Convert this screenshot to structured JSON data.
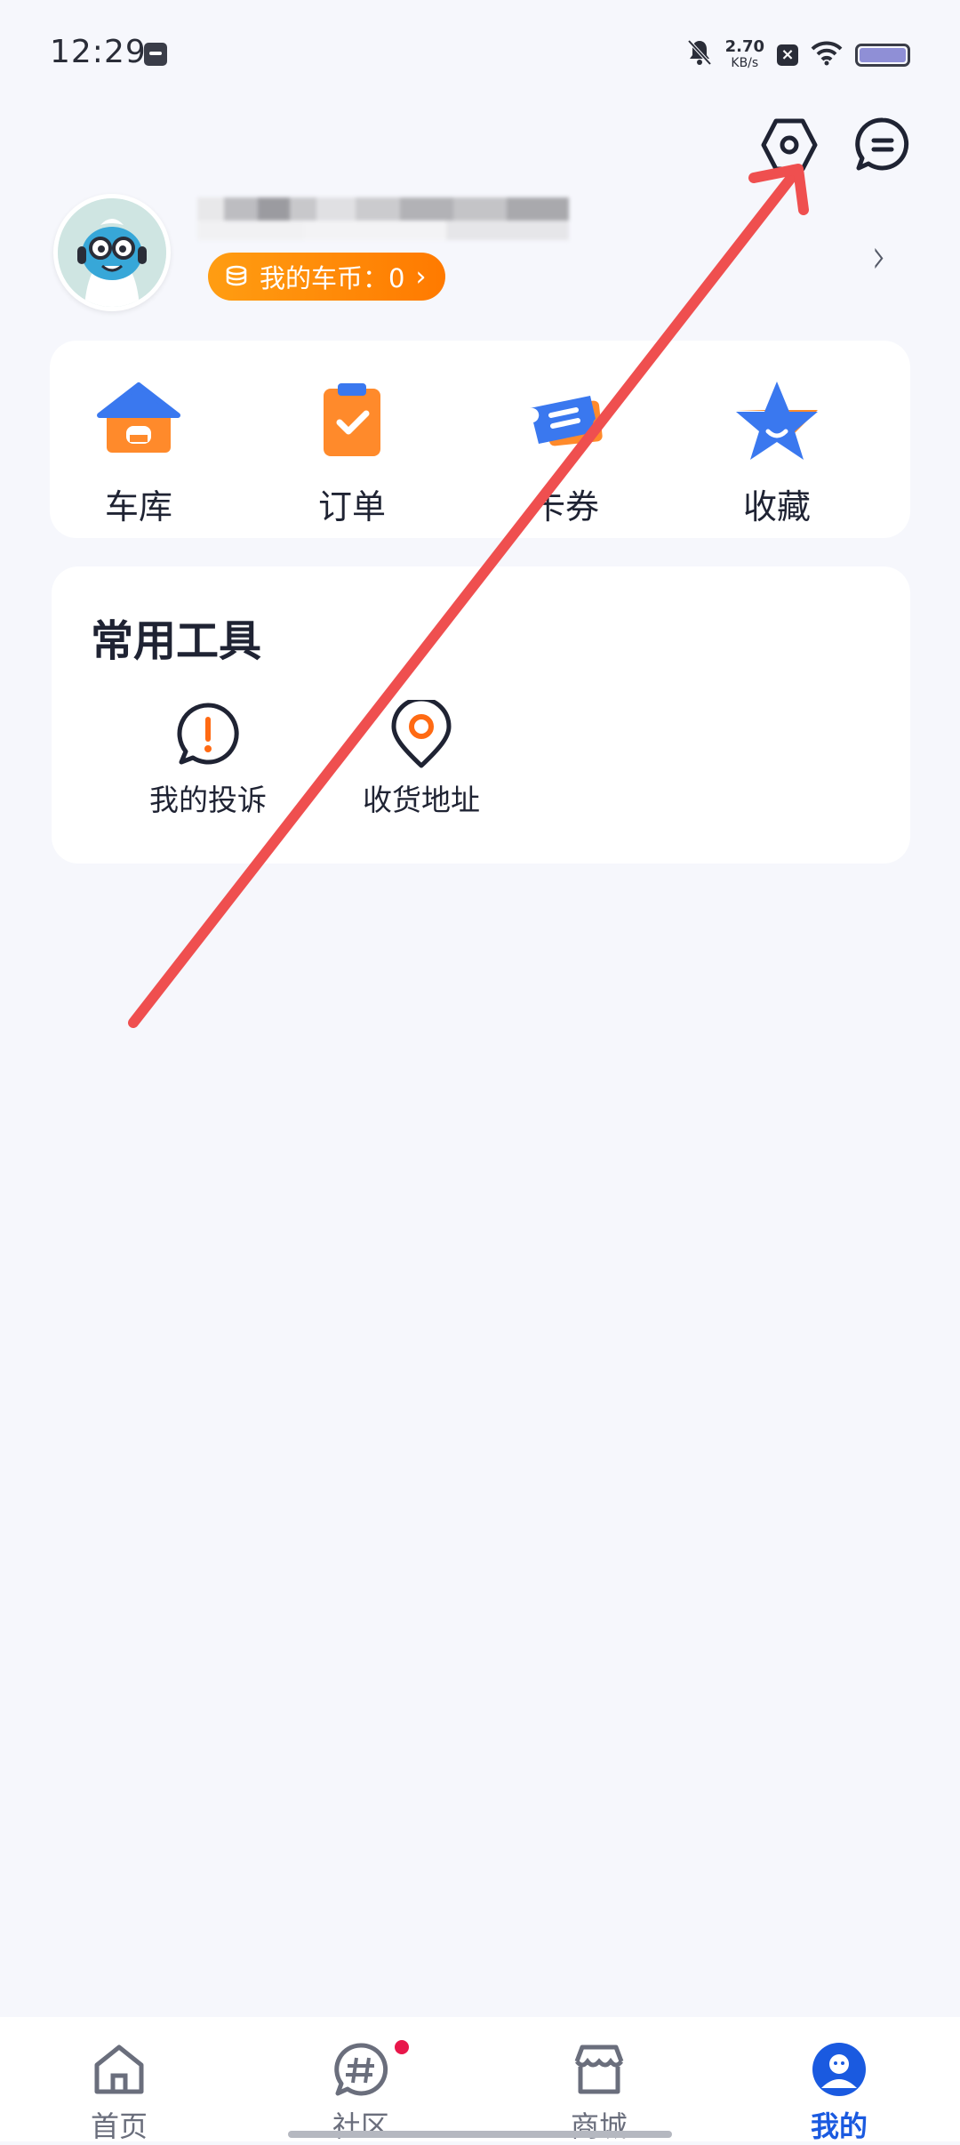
{
  "status_bar": {
    "time": "12:29",
    "net_speed_value": "2.70",
    "net_speed_unit": "KB/s",
    "icons": [
      "app-notification-icon",
      "mute-icon",
      "sim-off-icon",
      "wifi-icon",
      "battery-icon"
    ]
  },
  "header": {
    "icons": [
      "settings-icon",
      "message-icon"
    ]
  },
  "profile": {
    "coins_label": "我的车币：0",
    "coins_icon": "coin-stack-icon"
  },
  "quick_actions": [
    {
      "label": "车库",
      "icon": "garage-icon",
      "color": "#3a78ef"
    },
    {
      "label": "订单",
      "icon": "order-clipboard-icon",
      "color": "#ff8a2b"
    },
    {
      "label": "卡券",
      "icon": "ticket-icon",
      "color": "#3a78ef"
    },
    {
      "label": "收藏",
      "icon": "star-icon",
      "color": "#3a78ef"
    }
  ],
  "tools": {
    "title": "常用工具",
    "items": [
      {
        "label": "我的投诉",
        "icon": "complaint-icon"
      },
      {
        "label": "收货地址",
        "icon": "location-pin-icon"
      }
    ]
  },
  "bottom_nav": [
    {
      "label": "首页",
      "icon": "home-icon",
      "active": false
    },
    {
      "label": "社区",
      "icon": "community-hash-icon",
      "active": false,
      "badge": true
    },
    {
      "label": "商城",
      "icon": "store-icon",
      "active": false
    },
    {
      "label": "我的",
      "icon": "profile-icon",
      "active": true
    }
  ],
  "colors": {
    "accent": "#1a5ae0",
    "coins_pill": "#ff8a00",
    "annotation_arrow": "#ef4f4f",
    "background": "#f6f7fc"
  }
}
